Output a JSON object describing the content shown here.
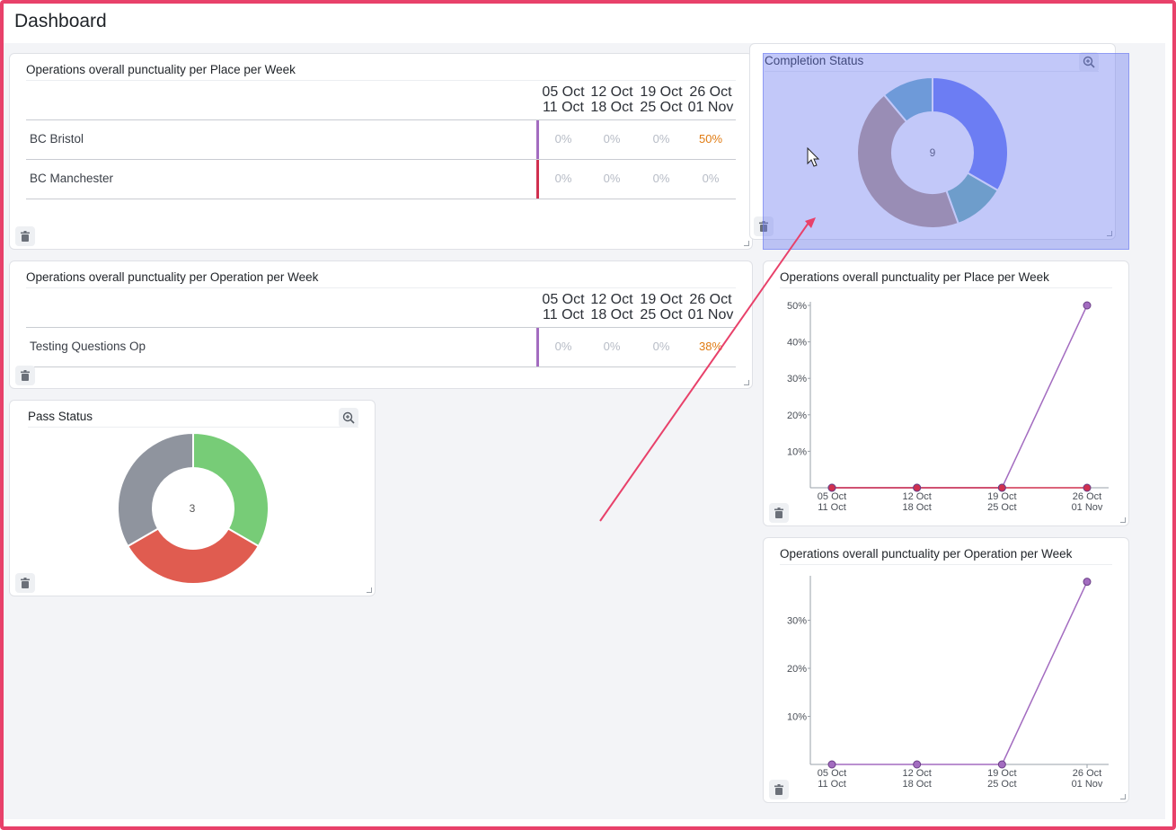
{
  "page": {
    "title": "Dashboard"
  },
  "colors": {
    "border_accent": "#e8416a",
    "hot_pct": "#e07b12",
    "muted_pct": "#b7bcc6",
    "line_place": "#a36cc0",
    "line_red": "#d0304f",
    "selection": "#6e7df0"
  },
  "place_table": {
    "title": "Operations overall punctuality per Place per Week",
    "columns": [
      {
        "from": "05 Oct",
        "to": "11 Oct"
      },
      {
        "from": "12 Oct",
        "to": "18 Oct"
      },
      {
        "from": "19 Oct",
        "to": "25 Oct"
      },
      {
        "from": "26 Oct",
        "to": "01 Nov"
      }
    ],
    "rows": [
      {
        "label": "BC Bristol",
        "values": [
          "0%",
          "0%",
          "0%",
          "50%"
        ],
        "bar_color": "#a36cc0"
      },
      {
        "label": "BC Manchester",
        "values": [
          "0%",
          "0%",
          "0%",
          "0%"
        ],
        "bar_color": "#d0304f"
      }
    ],
    "delete_icon": "trash-icon"
  },
  "operation_table": {
    "title": "Operations overall punctuality per Operation per Week",
    "columns": [
      {
        "from": "05 Oct",
        "to": "11 Oct"
      },
      {
        "from": "12 Oct",
        "to": "18 Oct"
      },
      {
        "from": "19 Oct",
        "to": "25 Oct"
      },
      {
        "from": "26 Oct",
        "to": "01 Nov"
      }
    ],
    "rows": [
      {
        "label": "Testing Questions Op",
        "values": [
          "0%",
          "0%",
          "0%",
          "38%"
        ],
        "bar_color": "#a36cc0"
      }
    ],
    "delete_icon": "trash-icon"
  },
  "pass_status": {
    "title": "Pass Status",
    "center_value": "3",
    "zoom_icon": "zoom-in-icon",
    "delete_icon": "trash-icon"
  },
  "completion_status": {
    "title": "Completion Status",
    "center_value": "9",
    "zoom_icon": "zoom-in-icon",
    "delete_icon": "trash-icon"
  },
  "chart_place": {
    "title": "Operations overall punctuality per Place per Week",
    "delete_icon": "trash-icon"
  },
  "chart_operation": {
    "title": "Operations overall punctuality per Operation per Week",
    "delete_icon": "trash-icon"
  },
  "chart_data": [
    {
      "type": "pie",
      "title": "Pass Status",
      "center_label": "3",
      "slices": [
        {
          "value": 1,
          "color": "#77cc77"
        },
        {
          "value": 1,
          "color": "#e05c50"
        },
        {
          "value": 1,
          "color": "#8f949e"
        }
      ]
    },
    {
      "type": "pie",
      "title": "Completion Status",
      "center_label": "9",
      "slices": [
        {
          "value": 3,
          "color": "#6b7ff5"
        },
        {
          "value": 1,
          "color": "#6fb6b0"
        },
        {
          "value": 4,
          "color": "#b99a8a"
        },
        {
          "value": 1,
          "color": "#6fb0c8"
        }
      ]
    },
    {
      "type": "line",
      "title": "Operations overall punctuality per Place per Week",
      "categories": [
        "05 Oct\n11 Oct",
        "12 Oct\n18 Oct",
        "19 Oct\n25 Oct",
        "26 Oct\n01 Nov"
      ],
      "category_lines": [
        [
          "05 Oct",
          "11 Oct"
        ],
        [
          "12 Oct",
          "18 Oct"
        ],
        [
          "19 Oct",
          "25 Oct"
        ],
        [
          "26 Oct",
          "01 Nov"
        ]
      ],
      "y_ticks": [
        "10%",
        "20%",
        "30%",
        "40%",
        "50%"
      ],
      "ylim": [
        0,
        50
      ],
      "series": [
        {
          "color": "#a36cc0",
          "values": [
            0,
            0,
            0,
            50
          ]
        },
        {
          "color": "#d0304f",
          "values": [
            0,
            0,
            0,
            0
          ]
        }
      ]
    },
    {
      "type": "line",
      "title": "Operations overall punctuality per Operation per Week",
      "categories": [
        "05 Oct\n11 Oct",
        "12 Oct\n18 Oct",
        "19 Oct\n25 Oct",
        "26 Oct\n01 Nov"
      ],
      "category_lines": [
        [
          "05 Oct",
          "11 Oct"
        ],
        [
          "12 Oct",
          "18 Oct"
        ],
        [
          "19 Oct",
          "25 Oct"
        ],
        [
          "26 Oct",
          "01 Nov"
        ]
      ],
      "y_ticks": [
        "10%",
        "20%",
        "30%"
      ],
      "ylim": [
        0,
        38.5
      ],
      "series": [
        {
          "color": "#a36cc0",
          "values": [
            0,
            0,
            0,
            38
          ]
        }
      ]
    }
  ]
}
